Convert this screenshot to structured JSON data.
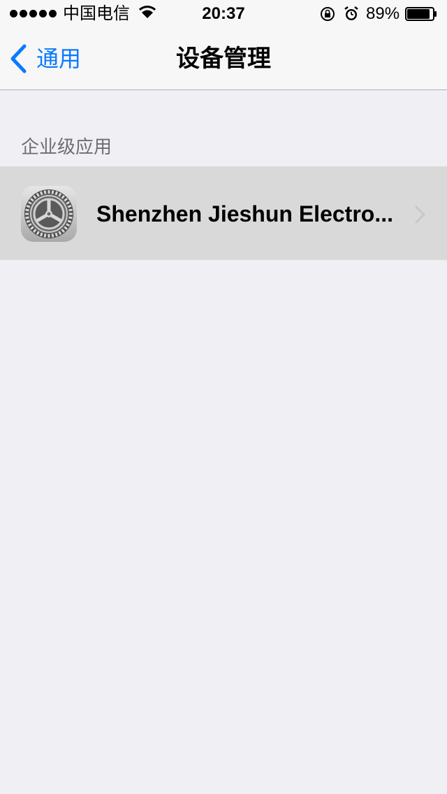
{
  "status_bar": {
    "carrier": "中国电信",
    "time": "20:37",
    "battery_percent": "89%",
    "battery_level": 0.89,
    "signal_bars": 5,
    "icons": [
      "signal-dots-icon",
      "wifi-icon",
      "rotation-lock-icon",
      "alarm-icon",
      "battery-icon"
    ]
  },
  "nav": {
    "back_label": "通用",
    "title": "设备管理",
    "accent_color": "#0a7aff"
  },
  "section": {
    "header": "企业级应用",
    "items": [
      {
        "label": "Shenzhen Jieshun Electro...",
        "icon": "settings-gear-icon",
        "chevron": "chevron-right-icon"
      }
    ]
  }
}
